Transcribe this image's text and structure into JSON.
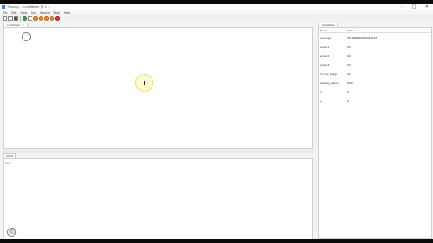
{
  "window": {
    "title": "Thonny - <untitled> @ 1 : 1"
  },
  "menu": [
    "File",
    "Edit",
    "View",
    "Run",
    "Device",
    "Tools",
    "Help"
  ],
  "toolbar": [
    "new-file",
    "open",
    "save",
    "run",
    "debug",
    "step-over",
    "step-into",
    "step-out",
    "resume",
    "stop"
  ],
  "editor": {
    "tab_label": "<untitled> ×"
  },
  "shell": {
    "tab_label": "Shell",
    "prompt": ">>> "
  },
  "variables": {
    "tab_label": "Variables",
    "headers": {
      "name": "Name",
      "value": "Value"
    },
    "rows": [
      {
        "name": "average",
        "value": "58.666666666666667"
      },
      {
        "name": "exam1",
        "value": "50"
      },
      {
        "name": "exam2",
        "value": "60"
      },
      {
        "name": "exam3",
        "value": "50"
      },
      {
        "name": "hourly_wage",
        "value": "20"
      },
      {
        "name": "weekly_salary",
        "value": "800"
      },
      {
        "name": "x",
        "value": "0"
      },
      {
        "name": "y",
        "value": "0"
      }
    ]
  }
}
